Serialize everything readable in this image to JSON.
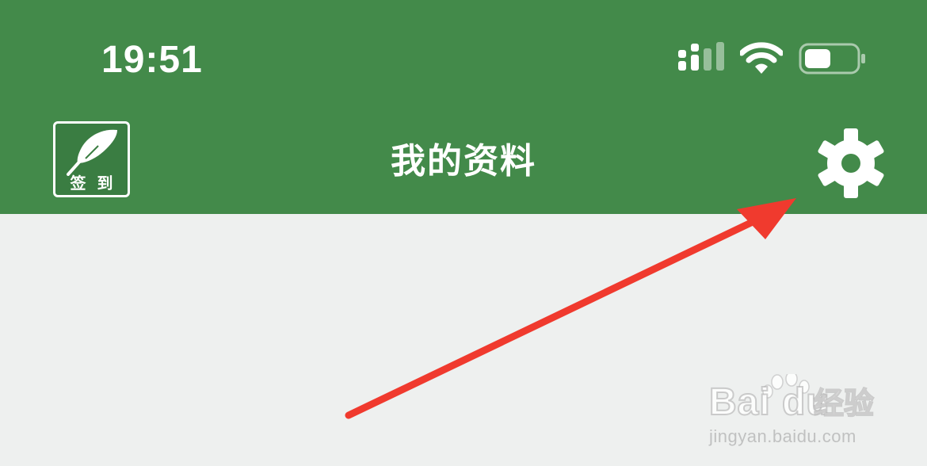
{
  "status_bar": {
    "time": "19:51",
    "signal_icon": "cellular-signal-icon",
    "wifi_icon": "wifi-icon",
    "battery_icon": "battery-icon"
  },
  "header": {
    "title": "我的资料",
    "checkin_label": "签到",
    "checkin_icon": "feather-icon",
    "settings_icon": "gear-icon",
    "background_color": "#438a4a"
  },
  "annotation": {
    "arrow_color": "#f03a2e",
    "arrow_icon": "red-arrow-annotation"
  },
  "watermark": {
    "brand": "Bai du",
    "brand_cn": "经验",
    "url": "jingyan.baidu.com"
  }
}
